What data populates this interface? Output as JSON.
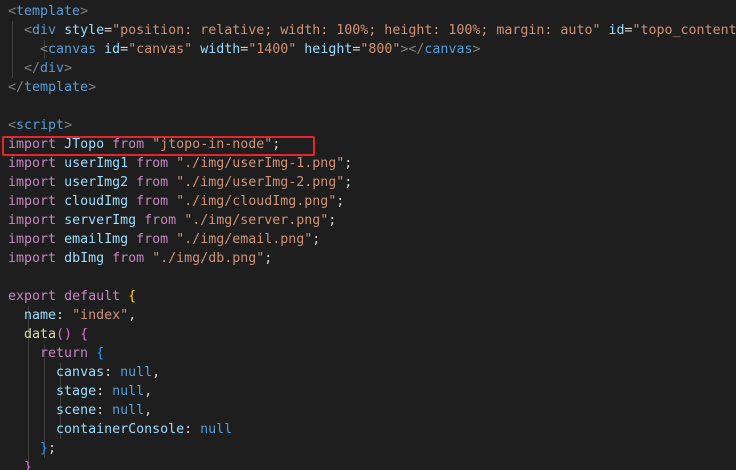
{
  "code_lines": [
    "<template>",
    "  <div style=\"position: relative; width: 100%; height: 100%; margin: auto\" id=\"topo_content\">",
    "    <canvas id=\"canvas\" width=\"1400\" height=\"800\"></canvas>",
    "  </div>",
    "</template>",
    "",
    "<script>",
    "import JTopo from \"jtopo-in-node\";",
    "import userImg1 from \"./img/userImg-1.png\";",
    "import userImg2 from \"./img/userImg-2.png\";",
    "import cloudImg from \"./img/cloudImg.png\";",
    "import serverImg from \"./img/server.png\";",
    "import emailImg from \"./img/email.png\";",
    "import dbImg from \"./img/db.png\";",
    "",
    "export default {",
    "  name: \"index\",",
    "  data() {",
    "    return {",
    "      canvas: null,",
    "      stage: null,",
    "      scene: null,",
    "      containerConsole: null",
    "    };",
    "  }"
  ],
  "colors": {
    "background": "#1e1e1e",
    "highlight_border": "#e5252a",
    "tag": "#569cd6",
    "attribute": "#9cdcfe",
    "string": "#ce9178",
    "keyword_control": "#c586c0",
    "function": "#dcdcaa"
  },
  "highlighted_line": "import JTopo from \"jtopo-in-node\";"
}
